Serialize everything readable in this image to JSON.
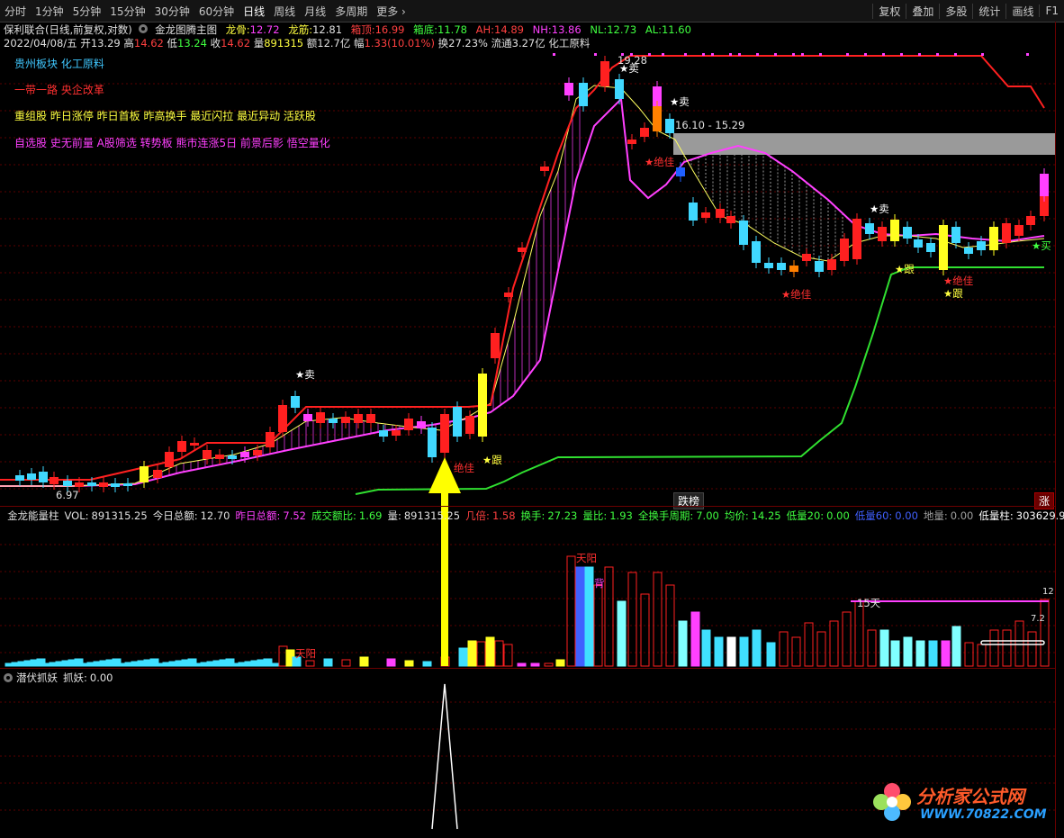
{
  "toolbar": {
    "periods": [
      "分时",
      "1分钟",
      "5分钟",
      "15分钟",
      "30分钟",
      "60分钟",
      "日线",
      "周线",
      "月线",
      "多周期",
      "更多"
    ],
    "active_period": "日线",
    "right_buttons": [
      "复权",
      "叠加",
      "多股",
      "统计",
      "画线",
      "F1"
    ]
  },
  "stock": {
    "title": "保利联合(日线,前复权,对数)",
    "indicator_name": "金龙图腾主图",
    "longgu_label": "龙骨:",
    "longgu_value": "12.72",
    "longjin_label": "龙筋:",
    "longjin_value": "12.81",
    "xiangding_label": "箱顶:",
    "xiangding_value": "16.99",
    "xiangdi_label": "箱底:",
    "xiangdi_value": "11.78",
    "ah_label": "AH:",
    "ah_value": "14.89",
    "nh_label": "NH:",
    "nh_value": "13.86",
    "nl_label": "NL:",
    "nl_value": "12.73",
    "al_label": "AL:",
    "al_value": "11.60",
    "date": "2022/04/08/五",
    "open_label": "开",
    "open": "13.29",
    "high_label": "高",
    "high": "14.62",
    "low_label": "低",
    "low": "13.24",
    "close_label": "收",
    "close": "14.62",
    "vol_label": "量",
    "vol": "891315",
    "amount_label": "额",
    "amount": "12.7亿",
    "change_label": "幅",
    "change": "1.33(10.01%)",
    "turnover_label": "换",
    "turnover": "27.23%",
    "float_label": "流通",
    "float": "3.27亿",
    "industry": "化工原料"
  },
  "tags": {
    "line1": "贵州板块  化工原料",
    "line2": "一带一路  央企改革",
    "line3": "重组股  昨日涨停  昨日首板  昨高换手  最近闪拉  最近异动  活跃股",
    "line4": "自选股  史无前量  A股筛选  转势板  熊市连涨5日  前景后影  悟空量化"
  },
  "annotations": {
    "high_price": "19.28",
    "low_price": "6.97",
    "box_range": "16.10 - 15.29",
    "sell1": "★卖",
    "sell2": "★卖",
    "sell3": "★卖",
    "sell4": "★卖",
    "jiajia1": "★绝佳",
    "jiajia2": "★绝佳",
    "jiajia3": "★绝佳",
    "jiajia4": "绝佳",
    "gen1": "★跟",
    "gen2": "★跟",
    "gen3": "★跟",
    "buy": "★买",
    "fall_bang": "跌榜",
    "zhang": "涨",
    "tianyang1": "天阳",
    "tianyang2": "天阳",
    "bei": "背",
    "tian15": "15天"
  },
  "vol_panel": {
    "name": "金龙能量柱",
    "items": [
      {
        "label": "VOL:",
        "value": "891315.25",
        "color": "#e0e0e0"
      },
      {
        "label": "今日总额:",
        "value": "12.70",
        "color": "#e0e0e0"
      },
      {
        "label": "昨日总额:",
        "value": "7.52",
        "color": "#ff40ff"
      },
      {
        "label": "成交额比:",
        "value": "1.69",
        "color": "#40ff40"
      },
      {
        "label": "量:",
        "value": "891315.25",
        "color": "#e0e0e0"
      },
      {
        "label": "几倍:",
        "value": "1.58",
        "color": "#ff4040"
      },
      {
        "label": "换手:",
        "value": "27.23",
        "color": "#40ff40"
      },
      {
        "label": "量比:",
        "value": "1.93",
        "color": "#40ff40"
      },
      {
        "label": "全换手周期:",
        "value": "7.00",
        "color": "#40ff40"
      },
      {
        "label": "均价:",
        "value": "14.25",
        "color": "#40ff40"
      },
      {
        "label": "低量20:",
        "value": "0.00",
        "color": "#40ff40"
      },
      {
        "label": "低量60:",
        "value": "0.00",
        "color": "#4060ff"
      },
      {
        "label": "地量:",
        "value": "0.00",
        "color": "#a0a0a0"
      },
      {
        "label": "低量柱:",
        "value": "303629.9",
        "color": "#ffffff"
      }
    ],
    "axis_label_1": "12",
    "axis_label_2": "7.2"
  },
  "ind_panel": {
    "name": "潜伏抓妖",
    "label": "抓妖:",
    "value": "0.00"
  },
  "watermark": {
    "line1": "分析家公式网",
    "line2": "WWW.70822.COM"
  },
  "colors": {
    "up": "#ff3030",
    "down": "#40e0ff",
    "ma_pink": "#ff40ff",
    "ma_yellow": "#ffff60",
    "ma_red": "#ff2020",
    "green_line": "#30e030",
    "grid": "#5a0000"
  }
}
